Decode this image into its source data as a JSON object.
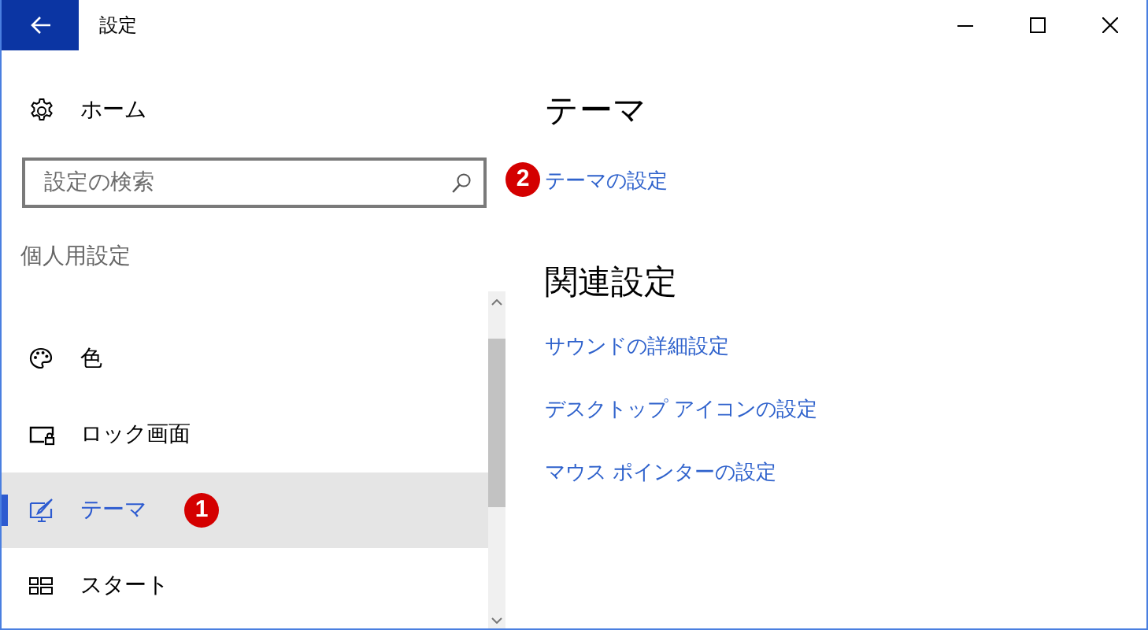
{
  "window": {
    "title": "設定"
  },
  "sidebar": {
    "home": "ホーム",
    "search": {
      "placeholder": "設定の検索"
    },
    "section": "個人用設定",
    "items": [
      {
        "label": "色",
        "selected": false
      },
      {
        "label": "ロック画面",
        "selected": false
      },
      {
        "label": "テーマ",
        "selected": true,
        "badge": "1"
      },
      {
        "label": "スタート",
        "selected": false
      }
    ]
  },
  "content": {
    "heading": "テーマ",
    "link": {
      "label": "テーマの設定",
      "badge": "2"
    },
    "related_heading": "関連設定",
    "related_links": [
      "サウンドの詳細設定",
      "デスクトップ アイコンの設定",
      "マウス ポインターの設定"
    ]
  }
}
